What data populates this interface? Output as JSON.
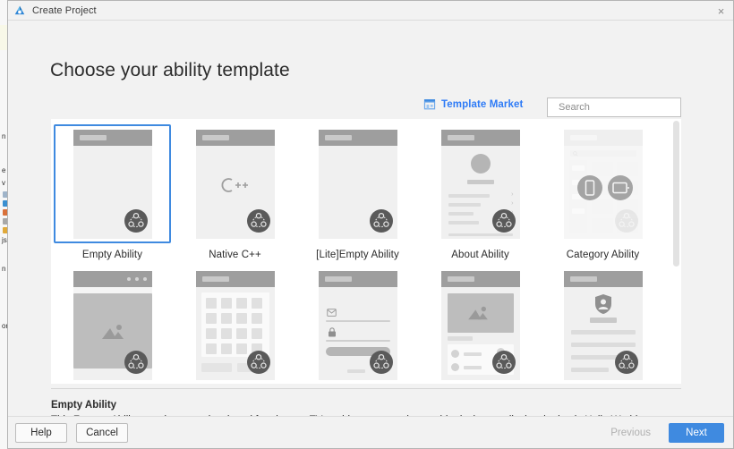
{
  "window": {
    "title": "Create Project",
    "app_icon": "deveco-logo-icon",
    "close_label": "×"
  },
  "page": {
    "heading": "Choose your ability template"
  },
  "toolbar": {
    "market_link": "Template Market",
    "market_icon": "shop-icon",
    "search_placeholder": "Search",
    "search_value": "",
    "search_icon": "search-icon"
  },
  "templates": [
    {
      "label": "Empty Ability",
      "selected": true,
      "art": "blank",
      "disabled": false
    },
    {
      "label": "Native C++",
      "selected": false,
      "art": "cpp",
      "disabled": false
    },
    {
      "label": "[Lite]Empty Ability",
      "selected": false,
      "art": "blank",
      "disabled": false
    },
    {
      "label": "About Ability",
      "selected": false,
      "art": "about",
      "disabled": false
    },
    {
      "label": "Category Ability",
      "selected": false,
      "art": "category",
      "disabled": true
    },
    {
      "label": "",
      "selected": false,
      "art": "gallery",
      "disabled": false
    },
    {
      "label": "",
      "selected": false,
      "art": "grid",
      "disabled": false
    },
    {
      "label": "",
      "selected": false,
      "art": "login",
      "disabled": false
    },
    {
      "label": "",
      "selected": false,
      "art": "news",
      "disabled": false
    },
    {
      "label": "",
      "selected": false,
      "art": "profile",
      "disabled": false
    }
  ],
  "description": {
    "title": "Empty Ability",
    "text": "This Feature Ability template was developed for phones, TVs, tablets, cars and wearable devices to display the basic Hello World functions."
  },
  "footer": {
    "help": "Help",
    "cancel": "Cancel",
    "previous": "Previous",
    "next": "Next"
  },
  "colors": {
    "accent": "#3f8ae0",
    "link": "#2e7bf6",
    "dialog_bg": "#f2f2f2",
    "panel_bg": "#ffffff",
    "badge": "#5a5a5a"
  }
}
